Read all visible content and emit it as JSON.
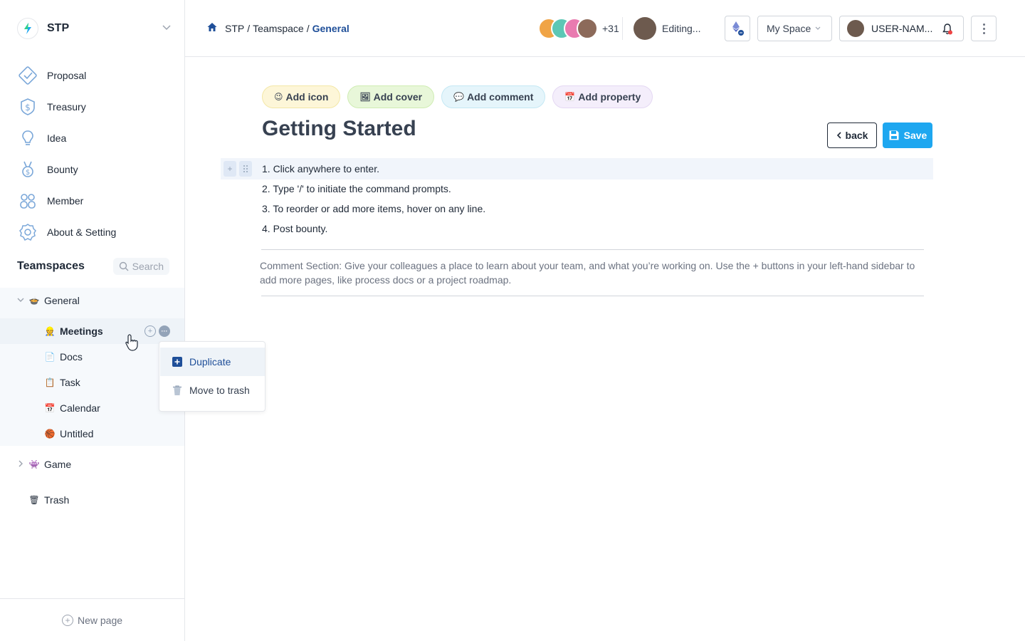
{
  "workspace": {
    "name": "STP"
  },
  "nav": [
    {
      "label": "Proposal",
      "icon": "proposal-icon"
    },
    {
      "label": "Treasury",
      "icon": "dollar-icon"
    },
    {
      "label": "Idea",
      "icon": "lightbulb-icon"
    },
    {
      "label": "Bounty",
      "icon": "medal-icon"
    },
    {
      "label": "Member",
      "icon": "members-icon"
    },
    {
      "label": "About & Setting",
      "icon": "gear-icon"
    }
  ],
  "teamspaces": {
    "title": "Teamspaces",
    "search_label": "Search",
    "general": {
      "label": "General",
      "emoji": "🍲"
    },
    "children": [
      {
        "label": "Meetings",
        "emoji": "👷"
      },
      {
        "label": "Docs",
        "emoji": "📄"
      },
      {
        "label": "Task",
        "emoji": "📋"
      },
      {
        "label": "Calendar",
        "emoji": "📅"
      },
      {
        "label": "Untitled",
        "emoji": "🏀"
      }
    ],
    "game": {
      "label": "Game",
      "emoji": "👾"
    },
    "trash": {
      "label": "Trash",
      "emoji": "🗑"
    }
  },
  "new_page_label": "New page",
  "context_menu": {
    "duplicate": "Duplicate",
    "move_to_trash": "Move to trash"
  },
  "breadcrumb": {
    "root": "STP",
    "middle": "Teamspace",
    "current": "General",
    "separator": "/"
  },
  "collaborators": {
    "extra_count": "+31",
    "editing_label": "Editing..."
  },
  "header": {
    "myspace_label": "My Space",
    "user_label": "USER-NAM..."
  },
  "chips": {
    "add_icon": "Add icon",
    "add_cover": "Add cover",
    "add_comment": "Add comment",
    "add_property": "Add property"
  },
  "page": {
    "title": "Getting Started",
    "back_label": "back",
    "save_label": "Save",
    "steps": [
      "1. Click anywhere to enter.",
      "2. Type '/' to initiate the command prompts.",
      "3. To reorder or add more items, hover on any line.",
      "4. Post bounty."
    ],
    "comment_section": "Comment Section: Give your colleagues a place to learn about your team, and what you’re working on. Use the + buttons in your left-hand sidebar to add more pages, like process docs or a project roadmap."
  },
  "colors": {
    "accent_blue": "#1ea7f0",
    "link_navy": "#1f4f99",
    "icon_blue": "#7aa7d9"
  }
}
